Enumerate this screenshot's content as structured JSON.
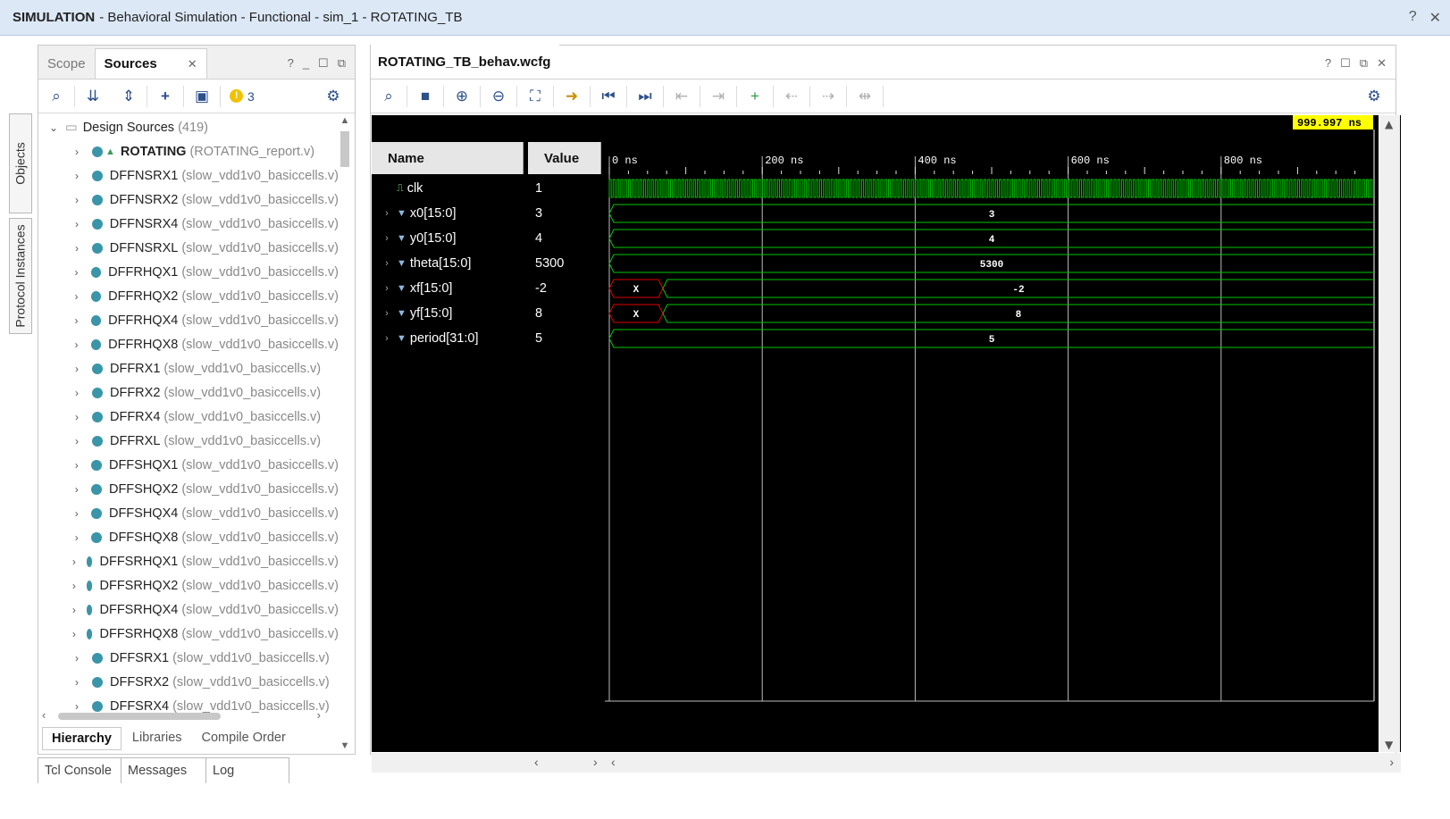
{
  "title": {
    "mode": "SIMULATION",
    "rest": "- Behavioral Simulation - Functional - sim_1 - ROTATING_TB",
    "controls": [
      "?",
      "✕"
    ]
  },
  "side_tabs": [
    "Objects",
    "Protocol Instances"
  ],
  "sources": {
    "tabs": [
      "Scope",
      "Sources"
    ],
    "close": "✕",
    "ctrls": [
      "?",
      "_",
      "☐",
      "⧉"
    ],
    "warn_count": "3",
    "root": {
      "label": "Design Sources",
      "count": "(419)"
    },
    "top": {
      "name": "ROTATING",
      "file": "(ROTATING_report.v)"
    },
    "items": [
      {
        "name": "DFFNSRX1",
        "file": "(slow_vdd1v0_basiccells.v)"
      },
      {
        "name": "DFFNSRX2",
        "file": "(slow_vdd1v0_basiccells.v)"
      },
      {
        "name": "DFFNSRX4",
        "file": "(slow_vdd1v0_basiccells.v)"
      },
      {
        "name": "DFFNSRXL",
        "file": "(slow_vdd1v0_basiccells.v)"
      },
      {
        "name": "DFFRHQX1",
        "file": "(slow_vdd1v0_basiccells.v)"
      },
      {
        "name": "DFFRHQX2",
        "file": "(slow_vdd1v0_basiccells.v)"
      },
      {
        "name": "DFFRHQX4",
        "file": "(slow_vdd1v0_basiccells.v)"
      },
      {
        "name": "DFFRHQX8",
        "file": "(slow_vdd1v0_basiccells.v)"
      },
      {
        "name": "DFFRX1",
        "file": "(slow_vdd1v0_basiccells.v)"
      },
      {
        "name": "DFFRX2",
        "file": "(slow_vdd1v0_basiccells.v)"
      },
      {
        "name": "DFFRX4",
        "file": "(slow_vdd1v0_basiccells.v)"
      },
      {
        "name": "DFFRXL",
        "file": "(slow_vdd1v0_basiccells.v)"
      },
      {
        "name": "DFFSHQX1",
        "file": "(slow_vdd1v0_basiccells.v)"
      },
      {
        "name": "DFFSHQX2",
        "file": "(slow_vdd1v0_basiccells.v)"
      },
      {
        "name": "DFFSHQX4",
        "file": "(slow_vdd1v0_basiccells.v)"
      },
      {
        "name": "DFFSHQX8",
        "file": "(slow_vdd1v0_basiccells.v)"
      },
      {
        "name": "DFFSRHQX1",
        "file": "(slow_vdd1v0_basiccells.v)"
      },
      {
        "name": "DFFSRHQX2",
        "file": "(slow_vdd1v0_basiccells.v)"
      },
      {
        "name": "DFFSRHQX4",
        "file": "(slow_vdd1v0_basiccells.v)"
      },
      {
        "name": "DFFSRHQX8",
        "file": "(slow_vdd1v0_basiccells.v)"
      },
      {
        "name": "DFFSRX1",
        "file": "(slow_vdd1v0_basiccells.v)"
      },
      {
        "name": "DFFSRX2",
        "file": "(slow_vdd1v0_basiccells.v)"
      },
      {
        "name": "DFFSRX4",
        "file": "(slow_vdd1v0_basiccells.v)"
      }
    ],
    "bottom_tabs": [
      "Hierarchy",
      "Libraries",
      "Compile Order"
    ]
  },
  "console_tabs": [
    "Tcl Console",
    "Messages",
    "Log"
  ],
  "wave": {
    "tab": "ROTATING_TB_behav.wcfg",
    "ctrls": [
      "?",
      "☐",
      "⧉",
      "✕"
    ],
    "cursor_time": "999.997 ns",
    "name_header": "Name",
    "value_header": "Value",
    "time_ticks": [
      "0 ns",
      "200 ns",
      "400 ns",
      "600 ns",
      "800 ns"
    ],
    "time_tick_values": [
      0,
      200,
      400,
      600,
      800
    ],
    "time_end": 1000,
    "signals": [
      {
        "name": "clk",
        "value": "1",
        "type": "clock"
      },
      {
        "name": "x0[15:0]",
        "value": "3",
        "type": "bus",
        "wave_label": "3"
      },
      {
        "name": "y0[15:0]",
        "value": "4",
        "type": "bus",
        "wave_label": "4"
      },
      {
        "name": "theta[15:0]",
        "value": "5300",
        "type": "bus",
        "wave_label": "5300"
      },
      {
        "name": "xf[15:0]",
        "value": "-2",
        "type": "bus_x",
        "x_label": "X",
        "wave_label": "-2"
      },
      {
        "name": "yf[15:0]",
        "value": "8",
        "type": "bus_x",
        "x_label": "X",
        "wave_label": "8"
      },
      {
        "name": "period[31:0]",
        "value": "5",
        "type": "bus",
        "wave_label": "5"
      }
    ],
    "colors": {
      "wave": "#00c800",
      "x_state": "#e00000",
      "cursor_bg": "#ffff00"
    }
  }
}
